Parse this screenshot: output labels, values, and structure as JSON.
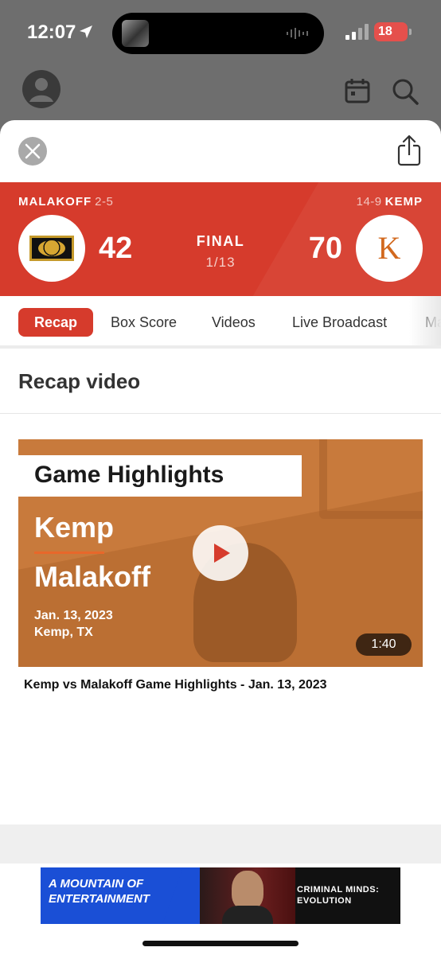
{
  "status_bar": {
    "time": "12:07",
    "battery": "18",
    "icons": [
      "location-arrow-icon",
      "signal-icon",
      "battery-charging-icon",
      "audio-wave-icon"
    ]
  },
  "app_header": {
    "icons": [
      "avatar-icon",
      "calendar-icon",
      "search-icon"
    ]
  },
  "game": {
    "away": {
      "name": "MALAKOFF",
      "record": "2-5",
      "score": "42"
    },
    "home": {
      "name": "KEMP",
      "record": "14-9",
      "score": "70",
      "logo_letter": "K"
    },
    "status": "FINAL",
    "date": "1/13"
  },
  "tabs": [
    {
      "label": "Recap",
      "active": true
    },
    {
      "label": "Box Score",
      "active": false
    },
    {
      "label": "Videos",
      "active": false
    },
    {
      "label": "Live Broadcast",
      "active": false
    },
    {
      "label": "Ma",
      "active": false
    }
  ],
  "section": {
    "title": "Recap video"
  },
  "video": {
    "banner": "Game Highlights",
    "team1": "Kemp",
    "team2": "Malakoff",
    "date": "Jan. 13, 2023",
    "place": "Kemp, TX",
    "duration": "1:40",
    "title": "Kemp vs Malakoff Game Highlights - Jan. 13, 2023"
  },
  "ad": {
    "line1": "A MOUNTAIN OF",
    "line2": "ENTERTAINMENT",
    "line3": "CRIMINAL MINDS:",
    "line4": "EVOLUTION"
  },
  "colors": {
    "accent": "#d63b2c",
    "overlay": "#6e6e6e",
    "video_bg": "#c87a3c",
    "ad_blue": "#1a4fd6"
  }
}
